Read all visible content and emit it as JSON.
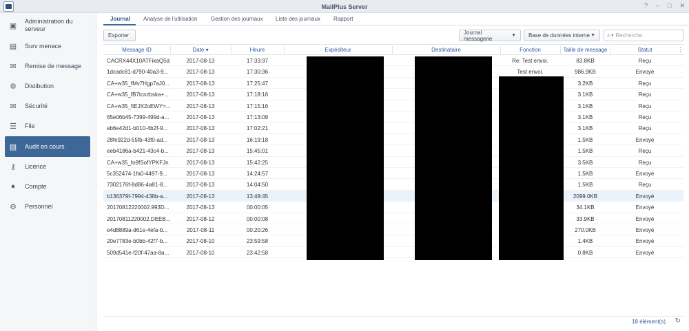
{
  "window": {
    "title": "MailPlus Server",
    "controls": [
      "?",
      "–",
      "□",
      "✕"
    ]
  },
  "sidebar": {
    "items": [
      {
        "label": "Administration du serveur",
        "icon": "server-icon",
        "glyph": "▣",
        "active": false
      },
      {
        "label": "Surv menace",
        "icon": "threat-monitor-icon",
        "glyph": "▤",
        "active": false
      },
      {
        "label": "Remise de message",
        "icon": "message-delivery-icon",
        "glyph": "✉",
        "active": false
      },
      {
        "label": "Distibution",
        "icon": "gear-icon",
        "glyph": "⚙",
        "active": false
      },
      {
        "label": "Sécurité",
        "icon": "envelope-shield-icon",
        "glyph": "✉",
        "active": false
      },
      {
        "label": "File",
        "icon": "queue-list-icon",
        "glyph": "☰",
        "active": false
      },
      {
        "label": "Audit en cours",
        "icon": "audit-document-icon",
        "glyph": "▤",
        "active": true
      },
      {
        "label": "Licence",
        "icon": "key-icon",
        "glyph": "⚷",
        "active": false
      },
      {
        "label": "Compte",
        "icon": "user-icon",
        "glyph": "●",
        "active": false
      },
      {
        "label": "Personnel",
        "icon": "gear-icon",
        "glyph": "⚙",
        "active": false
      }
    ]
  },
  "tabs": [
    "Journal",
    "Analyse de l'utilisation",
    "Gestion des journaux",
    "Liste des journaux",
    "Rapport"
  ],
  "toolbar": {
    "export_label": "Exporter",
    "log_type": "Journal messagerie",
    "database": "Base de données interne",
    "search_placeholder": "Recherche"
  },
  "table": {
    "columns": [
      "Message ID",
      "Date",
      "Heure",
      "Expéditeur",
      "Destinataire",
      "Fonction",
      "Taille de message",
      "Statut"
    ],
    "sort_indicator": "▾",
    "rows": [
      {
        "id": "CACRX44X10ATFikaQ5d...",
        "date": "2017-08-13",
        "time": "17:33:37",
        "fonction": "Re: Test envoi.",
        "size": "83.8KB",
        "status": "Reçu"
      },
      {
        "id": "1dcadc81-d790-40a3-9...",
        "date": "2017-08-13",
        "time": "17:30:36",
        "fonction": "Test envoi.",
        "size": "986.9KB",
        "status": "Envoyé"
      },
      {
        "id": "CA+w35_fMv7Hgp7aJ0...",
        "date": "2017-08-13",
        "time": "17:25:47",
        "fonction": "",
        "size": "3.2KB",
        "status": "Reçu"
      },
      {
        "id": "CA+w35_fB7tcnzbska+...",
        "date": "2017-08-13",
        "time": "17:18:16",
        "fonction": "",
        "size": "3.1KB",
        "status": "Reçu"
      },
      {
        "id": "CA+w35_ftEJX2oEWY=...",
        "date": "2017-08-13",
        "time": "17:15:16",
        "fonction": "",
        "size": "3.1KB",
        "status": "Reçu"
      },
      {
        "id": "65e06b45-7399-499d-a...",
        "date": "2017-08-13",
        "time": "17:13:09",
        "fonction": "",
        "size": "3.1KB",
        "status": "Reçu"
      },
      {
        "id": "eb6e42d1-b010-4b2f-9...",
        "date": "2017-08-13",
        "time": "17:02:21",
        "fonction": "",
        "size": "3.1KB",
        "status": "Reçu"
      },
      {
        "id": "28fe922d-55fb-43f0-ad...",
        "date": "2017-08-13",
        "time": "16:19:18",
        "fonction": "",
        "size": "1.5KB",
        "status": "Envoyé"
      },
      {
        "id": "eeb4186a-b421-43c4-b...",
        "date": "2017-08-13",
        "time": "15:45:01",
        "fonction": "",
        "size": "1.5KB",
        "status": "Reçu"
      },
      {
        "id": "CA+w35_fo9fSofYPKFJn...",
        "date": "2017-08-13",
        "time": "15:42:25",
        "fonction": "",
        "size": "3.5KB",
        "status": "Reçu"
      },
      {
        "id": "5c352474-1fa0-4497-9...",
        "date": "2017-08-13",
        "time": "14:24:57",
        "fonction": "",
        "size": "1.5KB",
        "status": "Envoyé"
      },
      {
        "id": "7302176f-8d86-4a81-8...",
        "date": "2017-08-13",
        "time": "14:04:50",
        "fonction": "",
        "size": "1.5KB",
        "status": "Reçu"
      },
      {
        "id": "b136379f-7994-438b-a...",
        "date": "2017-08-13",
        "time": "13:49:45",
        "fonction": "",
        "size": "2099.0KB",
        "status": "Envoyé"
      },
      {
        "id": "20170812220002.993D...",
        "date": "2017-08-13",
        "time": "00:00:05",
        "fonction": "",
        "size": "34.1KB",
        "status": "Envoyé"
      },
      {
        "id": "20170811220002.DEEB...",
        "date": "2017-08-12",
        "time": "00:00:08",
        "fonction": "",
        "size": "33.9KB",
        "status": "Envoyé"
      },
      {
        "id": "e4d8889a-d61e-4efa-b...",
        "date": "2017-08-11",
        "time": "00:20:26",
        "fonction": "",
        "size": "270.0KB",
        "status": "Envoyé"
      },
      {
        "id": "20e7783e-b0bb-42f7-b...",
        "date": "2017-08-10",
        "time": "23:59:58",
        "fonction": "",
        "size": "1.4KB",
        "status": "Envoyé"
      },
      {
        "id": "509d541e-f20f-47aa-8a...",
        "date": "2017-08-10",
        "time": "23:42:58",
        "fonction": "",
        "size": "0.8KB",
        "status": "Envoyé"
      }
    ],
    "selected_row": 12
  },
  "footer": {
    "count": "18 élément(s)"
  }
}
